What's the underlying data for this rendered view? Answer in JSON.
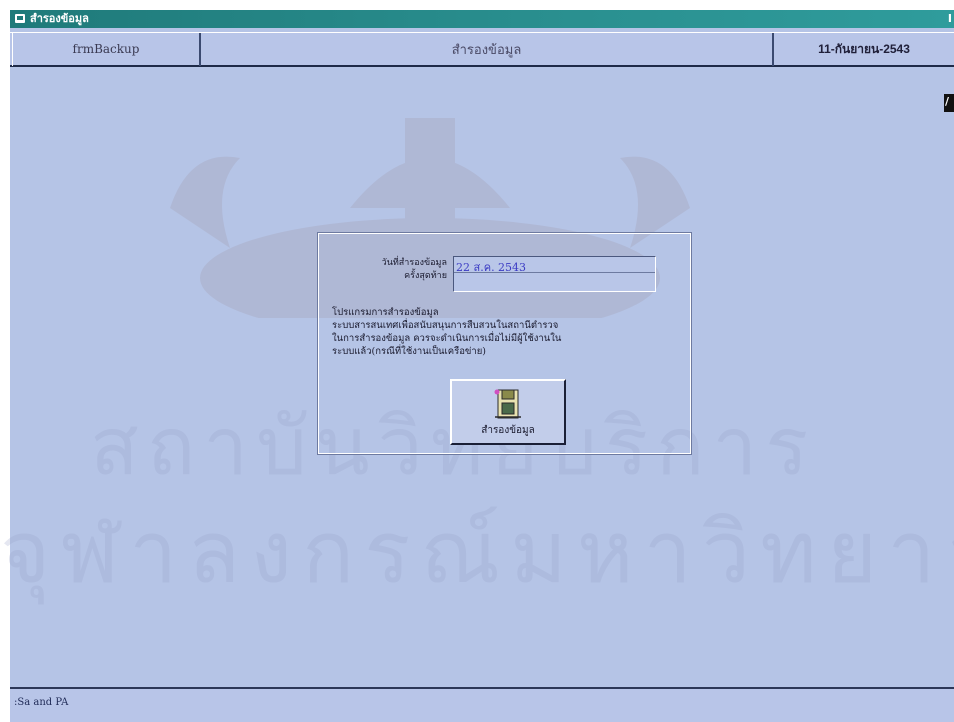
{
  "window": {
    "title": "สำรองข้อมูล",
    "edge_glyph": "I"
  },
  "header": {
    "form_name": "frmBackup",
    "screen_title": "สำรองข้อมูล",
    "date": "11-กันยายน-2543",
    "corner_glyph": "/"
  },
  "panel": {
    "last_backup_label_1": "วันที่สำรองข้อมูล",
    "last_backup_label_2": "ครั้งสุดท้าย",
    "last_backup_date": "22 ส.ค. 2543",
    "description": [
      "โปรแกรมการสำรองข้อมูล",
      "ระบบสารสนเทศเพื่อสนับสนุนการสืบสวนในสถานีตำรวจ",
      "ในการสำรองข้อมูล ควรจะดำเนินการเมื่อไม่มีผู้ใช้งานใน",
      "ระบบแล้ว(กรณีที่ใช้งานเป็นเครือข่าย)"
    ],
    "backup_button_label": "สำรองข้อมูล"
  },
  "status": {
    "text": ":Sa and PA"
  },
  "watermark": {
    "line1": "สถาบันวิทยบริการ",
    "line2": "จุฬาลงกรณ์มหาวิทยาลัย"
  },
  "colors": {
    "form_background": "#b5c4e6",
    "titlebar": "#1f7a7a",
    "date_text": "#3b3bc4"
  }
}
